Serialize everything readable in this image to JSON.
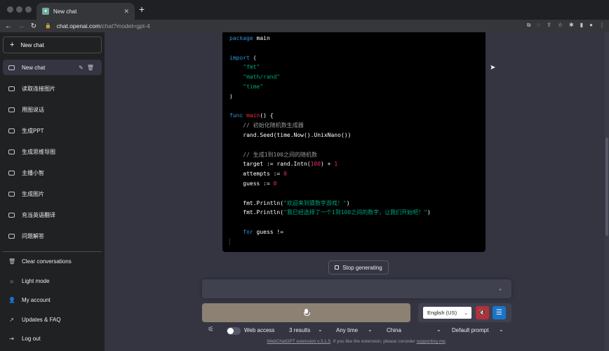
{
  "browser": {
    "tab_title": "New chat",
    "url_host": "chat.openai.com",
    "url_path": "/chat?model=gpt-4"
  },
  "sidebar": {
    "new_chat_label": "New chat",
    "conversations": [
      {
        "label": "New chat",
        "active": true
      },
      {
        "label": "读取连接图片"
      },
      {
        "label": "用图说话"
      },
      {
        "label": "生成PPT"
      },
      {
        "label": "生成思维导图"
      },
      {
        "label": "主播小智"
      },
      {
        "label": "生成图片"
      },
      {
        "label": "充当英语翻译"
      },
      {
        "label": "问题解答"
      }
    ],
    "bottom_items": [
      {
        "label": "Clear conversations",
        "icon": "trash-icon"
      },
      {
        "label": "Light mode",
        "icon": "sun-icon"
      },
      {
        "label": "My account",
        "icon": "user-icon"
      },
      {
        "label": "Updates & FAQ",
        "icon": "external-link-icon"
      },
      {
        "label": "Log out",
        "icon": "logout-icon"
      }
    ]
  },
  "code": {
    "lines": {
      "l1_kw": "package",
      "l1_rest": " main",
      "l3_kw": "import",
      "l3_rest": " (",
      "l4": "\"fmt\"",
      "l5": "\"math/rand\"",
      "l6": "\"time\"",
      "l7": ")",
      "l9_kw": "func",
      "l9_fn": "main",
      "l9_rest": "() {",
      "l10": "// 初始化随机数生成器",
      "l11": "rand.Seed(time.Now().UnixNano())",
      "l13": "// 生成1到100之间的随机数",
      "l14_a": "target := rand.Intn(",
      "l14_n1": "100",
      "l14_b": ") + ",
      "l14_n2": "1",
      "l15_a": "attempts := ",
      "l15_n": "0",
      "l16_a": "guess := ",
      "l16_n": "0",
      "l18_a": "fmt.Println(",
      "l18_s": "\"欢迎来到猜数字游戏！\"",
      "l18_b": ")",
      "l19_a": "fmt.Println(",
      "l19_s": "\"我已经选择了一个1到100之间的数字，让我们开始吧！\"",
      "l19_b": ")",
      "l21_kw": "for",
      "l21_rest": " guess !="
    }
  },
  "main": {
    "stop_label": "Stop generating",
    "language": "English (US)",
    "toolbar": {
      "web_access": "Web access",
      "results": "3 results",
      "time": "Any time",
      "region": "China",
      "prompt": "Default prompt"
    },
    "footer": {
      "link1": "WebChatGPT extension v.3.1.5",
      "middle": ". If you like the extension, please consider ",
      "link2": "supporting me",
      "end": "."
    }
  },
  "colors": {
    "sidebar_bg": "#202123",
    "main_bg": "#343541",
    "mic_bar": "#8c8173",
    "mute_button": "#b0303b",
    "settings_button": "#1b74c8"
  }
}
